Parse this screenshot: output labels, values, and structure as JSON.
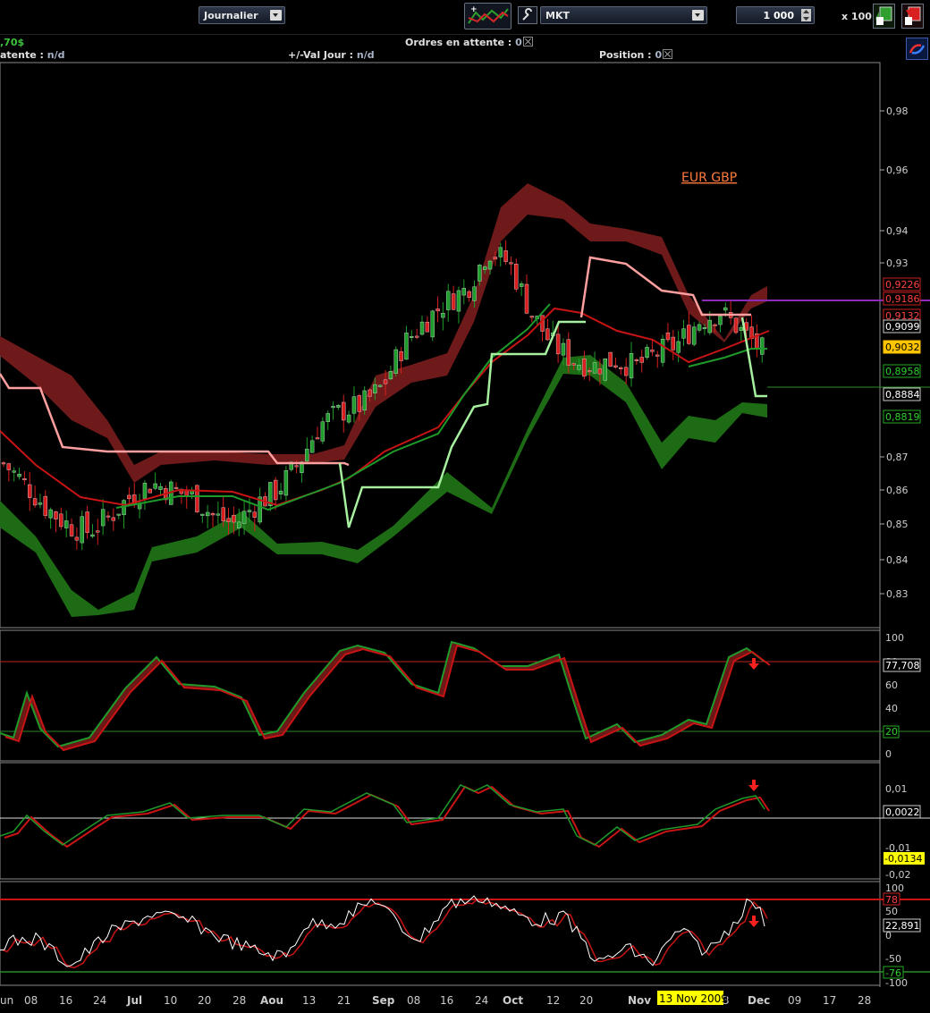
{
  "toolbar": {
    "period": "Journalier",
    "order_type": "MKT",
    "quantity": "1 000",
    "multiplier": "x 100"
  },
  "info_bar": {
    "balance_fragment": ",70$",
    "pending_label": "Ordres en attente :",
    "pending_value": "0",
    "attente_label": "atente :",
    "attente_value": "n/d",
    "val_jour_label": "+/-Val Jour :",
    "val_jour_value": "n/d",
    "position_label": "Position :",
    "position_value": "0"
  },
  "colors": {
    "price_up": "#1e9e2a",
    "price_down": "#d81e1e",
    "upper_band": "#6e1a1a",
    "lower_band": "#1d6b14",
    "moving_avg": "#c81414",
    "trend_line_upper": "#ff9f9f",
    "trend_line_lower": "#a6f0a0",
    "last_price_bg": "#ffc400",
    "date_marker_bg": "#ffff00"
  },
  "main_chart": {
    "title": "EUR GBP",
    "y_ticks": [
      "0,98",
      "0,96",
      "0,94",
      "0,93",
      "0,87",
      "0,86",
      "0,85",
      "0,84",
      "0,83"
    ],
    "price_labels": [
      "0,9226",
      "0,9186",
      "0,9132",
      "0,9099",
      "0,9032",
      "0,8958",
      "0,8884",
      "0,8819"
    ],
    "last_price": "0,9032"
  },
  "oscillator1": {
    "ticks": [
      "100",
      "80",
      "60",
      "40",
      "20",
      "0"
    ],
    "value": "77,708",
    "low_level": "20"
  },
  "oscillator2": {
    "ticks": [
      "0,01",
      "-0,01",
      "-0,02"
    ],
    "value": "0,0022",
    "value2": "-0,0134"
  },
  "oscillator3": {
    "ticks": [
      "100",
      "50",
      "0",
      "-50",
      "-100"
    ],
    "value": "22,891",
    "high_level": "78",
    "low_level": "-76"
  },
  "x_axis": {
    "labels": [
      "un",
      "08",
      "16",
      "24",
      "Jul",
      "10",
      "20",
      "28",
      "Aou",
      "13",
      "21",
      "Sep",
      "08",
      "16",
      "24",
      "Oct",
      "12",
      "20",
      "Nov",
      "3",
      "Dec",
      "09",
      "17",
      "28"
    ],
    "marker_date": "13 Nov 2009"
  },
  "chart_data": {
    "type": "line",
    "title": "EUR GBP",
    "x_labels": [
      "un",
      "08",
      "16",
      "24",
      "Jul",
      "10",
      "20",
      "28",
      "Aou",
      "13",
      "21",
      "Sep",
      "08",
      "16",
      "24",
      "Oct",
      "12",
      "20",
      "Nov",
      "3",
      "Dec",
      "09",
      "17",
      "28"
    ],
    "ylim": [
      0.825,
      0.99
    ],
    "series": [],
    "close_approx": [
      0.868,
      0.862,
      0.855,
      0.85,
      0.848,
      0.852,
      0.858,
      0.862,
      0.86,
      0.858,
      0.852,
      0.85,
      0.856,
      0.86,
      0.868,
      0.88,
      0.884,
      0.886,
      0.892,
      0.905,
      0.912,
      0.918,
      0.922,
      0.934,
      0.93,
      0.915,
      0.905,
      0.9,
      0.898,
      0.9,
      0.898,
      0.902,
      0.905,
      0.912,
      0.915,
      0.909,
      0.903
    ]
  }
}
